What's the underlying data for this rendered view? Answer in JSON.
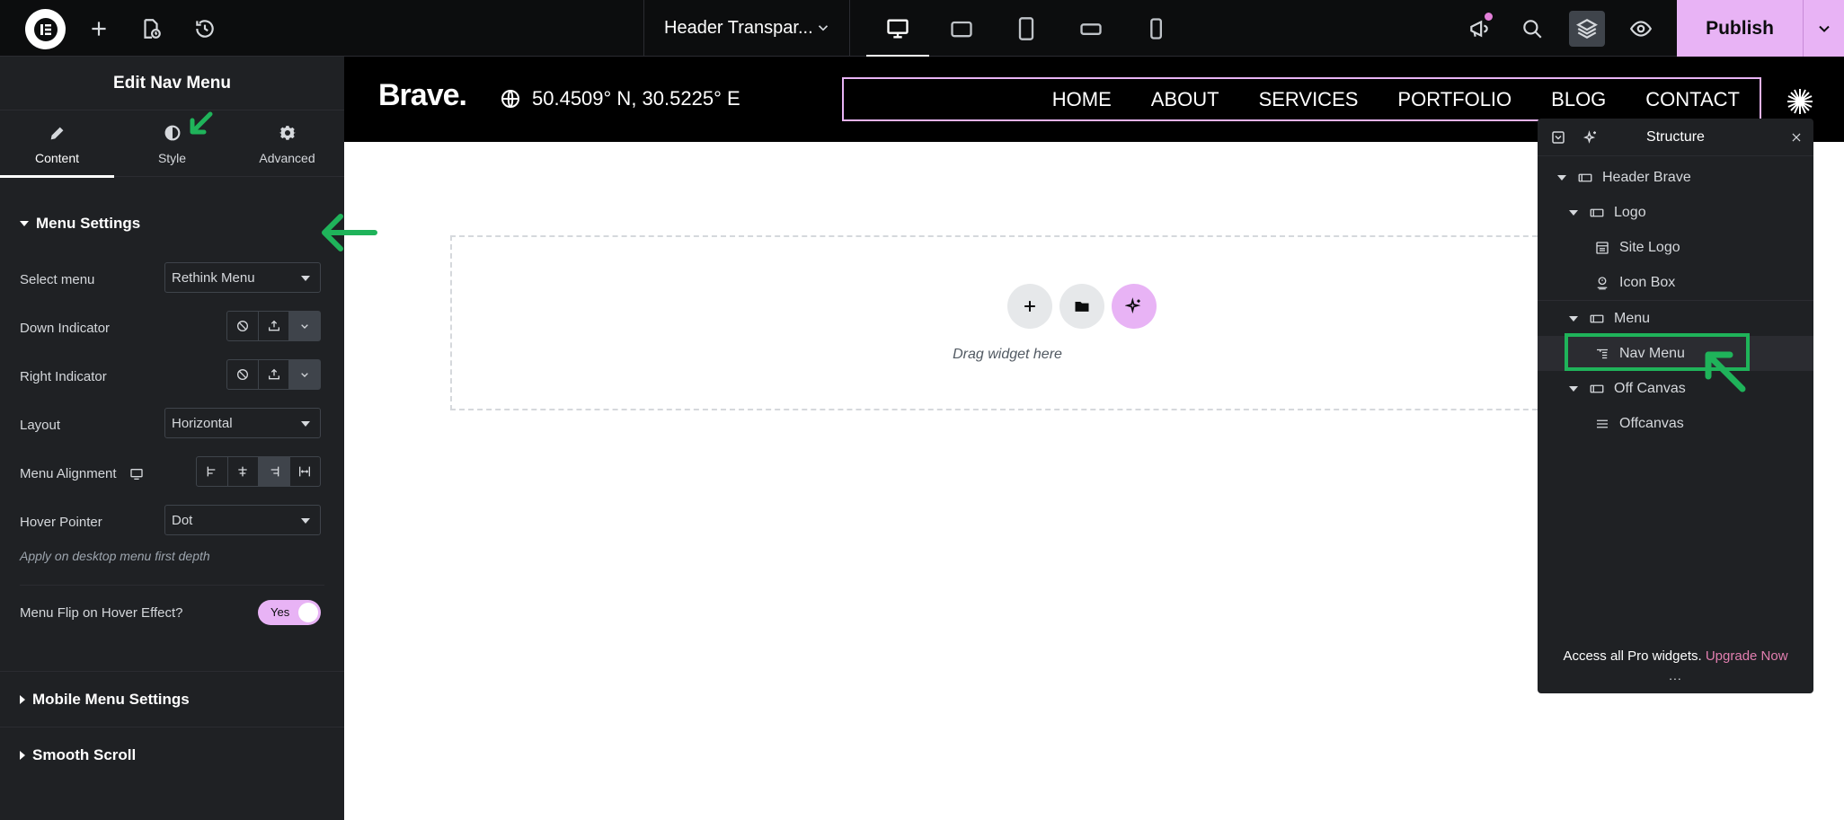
{
  "topbar": {
    "document_title": "Header Transpar...",
    "publish_label": "Publish",
    "devices": [
      "desktop",
      "tablet-landscape",
      "tablet-portrait",
      "mobile-landscape",
      "mobile-portrait"
    ],
    "active_device": "desktop"
  },
  "panel": {
    "title": "Edit Nav Menu",
    "tabs": [
      {
        "label": "Content",
        "icon": "pencil-icon",
        "active": true
      },
      {
        "label": "Style",
        "icon": "half-circle-icon",
        "active": false
      },
      {
        "label": "Advanced",
        "icon": "gear-icon",
        "active": false
      }
    ],
    "menu_settings": {
      "heading": "Menu Settings",
      "select_menu_label": "Select menu",
      "select_menu_value": "Rethink Menu",
      "down_indicator_label": "Down Indicator",
      "right_indicator_label": "Right Indicator",
      "layout_label": "Layout",
      "layout_value": "Horizontal",
      "menu_alignment_label": "Menu Alignment",
      "hover_pointer_label": "Hover Pointer",
      "hover_pointer_value": "Dot",
      "hint": "Apply on desktop menu first depth",
      "flip_label": "Menu Flip on Hover Effect?",
      "flip_value": "Yes"
    },
    "mobile_menu_heading": "Mobile Menu Settings",
    "smooth_scroll_heading": "Smooth Scroll"
  },
  "canvas": {
    "brand": "Brave.",
    "coordinates": "50.4509° N, 30.5225° E",
    "nav_items": [
      "HOME",
      "ABOUT",
      "SERVICES",
      "PORTFOLIO",
      "BLOG",
      "CONTACT"
    ],
    "drop_text": "Drag widget here"
  },
  "structure": {
    "title": "Structure",
    "items": [
      {
        "label": "Header Brave",
        "level": 0,
        "caret": true,
        "icon": "container-icon"
      },
      {
        "label": "Logo",
        "level": 1,
        "caret": true,
        "icon": "container-icon"
      },
      {
        "label": "Site Logo",
        "level": 2,
        "caret": false,
        "icon": "site-logo-icon"
      },
      {
        "label": "Icon Box",
        "level": 2,
        "caret": false,
        "icon": "icon-box-icon"
      },
      {
        "label": "Menu",
        "level": 1,
        "caret": true,
        "icon": "container-icon"
      },
      {
        "label": "Nav Menu",
        "level": 2,
        "caret": false,
        "icon": "nav-menu-icon",
        "active": true
      },
      {
        "label": "Off Canvas",
        "level": 1,
        "caret": true,
        "icon": "container-icon"
      },
      {
        "label": "Offcanvas",
        "level": 2,
        "caret": false,
        "icon": "hamburger-icon"
      }
    ],
    "footer_text": "Access all Pro widgets.",
    "footer_link": "Upgrade Now",
    "grip": "..."
  },
  "colors": {
    "accent": "#e8b3f5",
    "annotation": "#1fb35a",
    "panel_bg": "#1f2124",
    "topbar_bg": "#0c0d0e",
    "upgrade_link": "#e27fb0"
  }
}
